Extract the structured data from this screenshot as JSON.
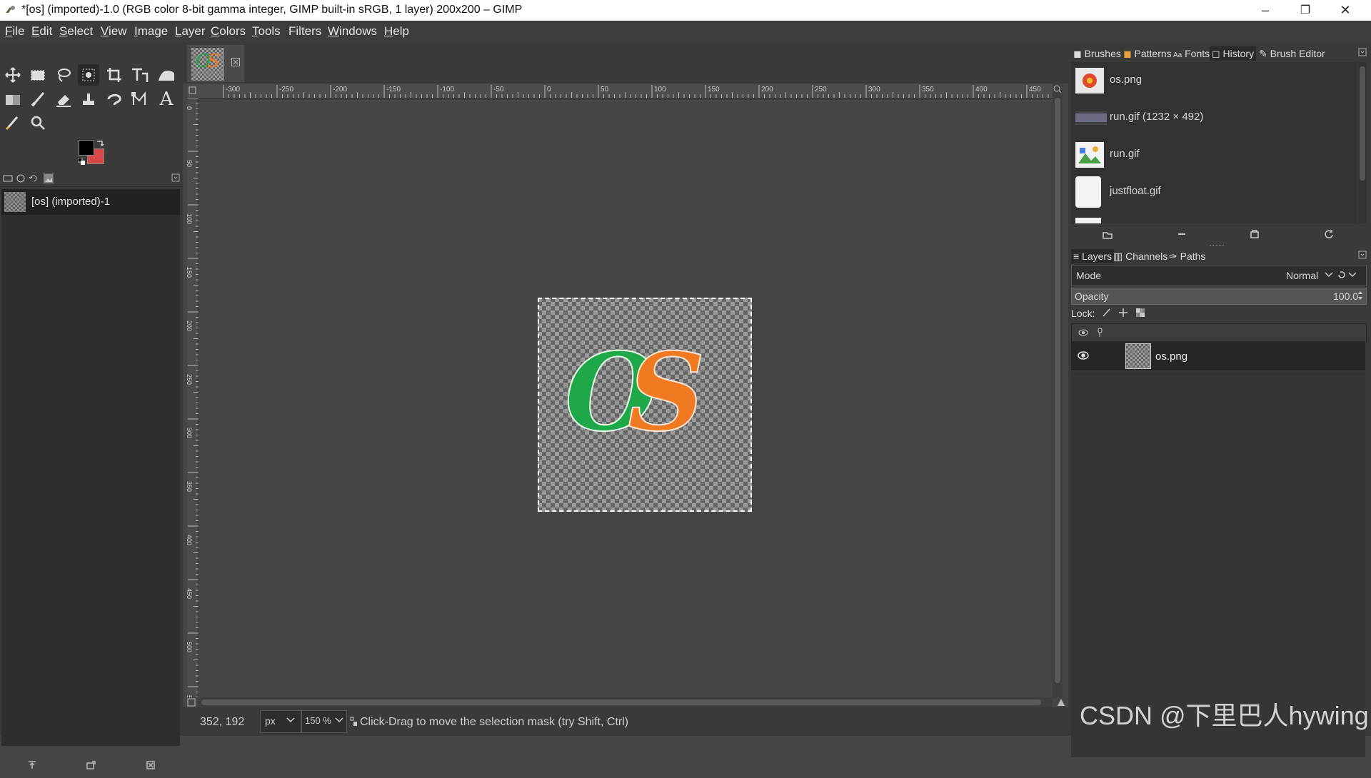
{
  "window": {
    "title": "*[os] (imported)-1.0 (RGB color 8-bit gamma integer, GIMP built-in sRGB, 1 layer) 200x200 – GIMP",
    "minimize": "–",
    "maximize": "❐",
    "close": "✕"
  },
  "menubar": {
    "items": [
      {
        "key": "F",
        "rest": "ile"
      },
      {
        "key": "E",
        "rest": "dit"
      },
      {
        "key": "S",
        "rest": "elect"
      },
      {
        "key": "V",
        "rest": "iew"
      },
      {
        "key": "I",
        "rest": "mage"
      },
      {
        "key": "L",
        "rest": "ayer"
      },
      {
        "key": "C",
        "rest": "olors"
      },
      {
        "key": "T",
        "rest": "ools"
      },
      {
        "key": "",
        "rest": "Filters"
      },
      {
        "key": "W",
        "rest": "indows"
      },
      {
        "key": "H",
        "rest": "elp"
      }
    ]
  },
  "toolbox": {
    "foreground_color": "#000000",
    "background_color": "#d94848"
  },
  "images_panel": {
    "items": [
      {
        "label": "[os] (imported)-1"
      }
    ]
  },
  "canvas": {
    "ruler_h_labels": [
      "-300",
      "-250",
      "-200",
      "-150",
      "-100",
      "-50",
      "0",
      "50",
      "100",
      "150",
      "200",
      "250",
      "300",
      "350",
      "400",
      "450"
    ],
    "ruler_v_labels": [
      "0",
      "50",
      "100",
      "150",
      "200",
      "250",
      "300",
      "350",
      "400",
      "450",
      "500",
      "550"
    ],
    "image_text": {
      "green": "O",
      "orange": "S"
    },
    "green_color": "#1ea84a",
    "orange_color": "#f07a22"
  },
  "statusbar": {
    "coords": "352, 192",
    "unit": "px",
    "zoom": "150 %",
    "message": "Click-Drag to move the selection mask (try Shift, Ctrl)"
  },
  "top_dock": {
    "tabs": [
      "Brushes",
      "Patterns",
      "Fonts",
      "History",
      "Brush Editor"
    ],
    "selected_tab": "History",
    "history": [
      {
        "label": "os.png"
      },
      {
        "label": "run.gif (1232 × 492)"
      },
      {
        "label": "run.gif"
      },
      {
        "label": "justfloat.gif"
      }
    ]
  },
  "layers_dock": {
    "tabs": [
      "Layers",
      "Channels",
      "Paths"
    ],
    "mode_label": "Mode",
    "mode_value": "Normal",
    "opacity_label": "Opacity",
    "opacity_value": "100.0",
    "lock_label": "Lock:",
    "layers": [
      {
        "name": "os.png"
      }
    ]
  },
  "watermark": "CSDN @下里巴人hywing"
}
